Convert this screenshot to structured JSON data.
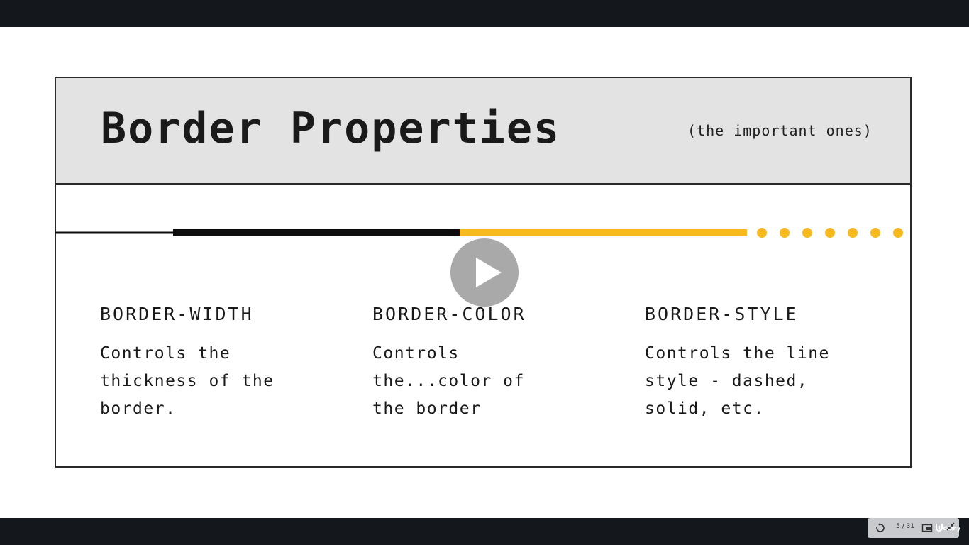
{
  "slide": {
    "title": "Border Properties",
    "subtitle": "(the important ones)",
    "columns": [
      {
        "heading": "BORDER-WIDTH",
        "body": "Controls the\nthickness of the\nborder."
      },
      {
        "heading": "BORDER-COLOR",
        "body": "Controls\nthe...color of\nthe border"
      },
      {
        "heading": "BORDER-STYLE",
        "body": "Controls the line\nstyle - dashed,\nsolid, etc."
      }
    ]
  },
  "player": {
    "page_counter": "5 / 31",
    "brand": "Udemy",
    "icons": [
      "replay-icon",
      "play-icon",
      "picture-in-picture-icon",
      "collapse-icon"
    ]
  },
  "colors": {
    "accent": "#f7b91e",
    "line": "#0d0d0d"
  }
}
